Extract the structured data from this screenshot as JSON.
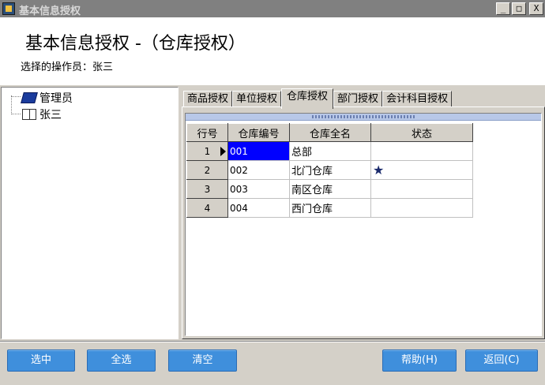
{
  "window": {
    "title": "基本信息授权",
    "min_label": "_",
    "max_label": "□",
    "close_label": "X"
  },
  "header": {
    "page_title": "基本信息授权 -（仓库授权）",
    "operator_text": "选择的操作员：张三"
  },
  "tree": {
    "nodes": [
      {
        "label": "管理员",
        "icon": "closed-book-icon"
      },
      {
        "label": "张三",
        "icon": "open-book-icon"
      }
    ]
  },
  "tabs": [
    {
      "label": "商品授权",
      "active": false
    },
    {
      "label": "单位授权",
      "active": false
    },
    {
      "label": "仓库授权",
      "active": true
    },
    {
      "label": "部门授权",
      "active": false
    },
    {
      "label": "会计科目授权",
      "active": false
    }
  ],
  "grid": {
    "columns": [
      "行号",
      "仓库编号",
      "仓库全名",
      "状态"
    ],
    "rows": [
      {
        "num": "1",
        "code": "001",
        "name": "总部",
        "status": ""
      },
      {
        "num": "2",
        "code": "002",
        "name": "北门仓库",
        "status": "★"
      },
      {
        "num": "3",
        "code": "003",
        "name": "南区仓库",
        "status": ""
      },
      {
        "num": "4",
        "code": "004",
        "name": "西门仓库",
        "status": ""
      }
    ]
  },
  "buttons": {
    "select": "选中",
    "select_all": "全选",
    "clear": "清空",
    "help": "帮助(H)",
    "back": "返回(C)"
  },
  "colors": {
    "selection": "#0000ff",
    "button": "#3f8fdc",
    "star": "#1a2a6c"
  }
}
